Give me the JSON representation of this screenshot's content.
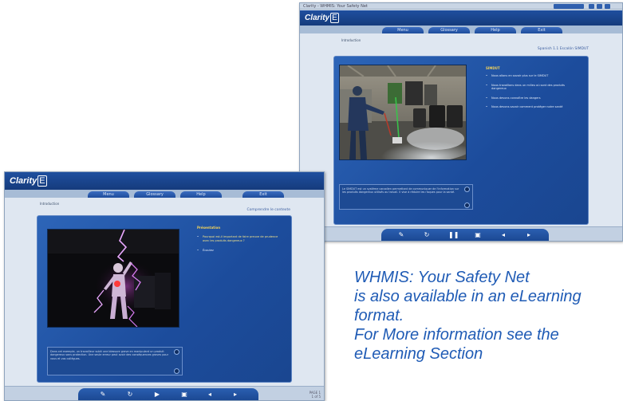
{
  "promo": {
    "lines": [
      "WHMIS: Your Safety Net",
      "is also available in an eLearning",
      "format.",
      "For More information see the",
      "eLearning Section"
    ]
  },
  "back_screenshot": {
    "window_title": "Clarity - WHMIS: Your Safety Net",
    "logo_text": "Clarity",
    "logo_box": "E",
    "nav_tabs": [
      "Menu",
      "Glossary",
      "Help",
      "Exit"
    ],
    "breadcrumb": "Introduction",
    "lesson_title": "Spanish 1.1 Escalón SIMDUT",
    "sidebar_title": "SIMDUT",
    "bullets": [
      "Nous allons en savoir plus sur le SIMDUT",
      "Nous travaillons dans un milieu où sont des produits dangereux",
      "Nous devons connaître les dangers",
      "Nous devons savoir comment protéger notre santé"
    ],
    "caption": "Le SIMDUT est un système canadien permettant de communiquer de l'information sur les produits dangereux utilisés au travail. Il vise à réduire les risques pour la santé.",
    "controls": [
      "pencil-icon",
      "refresh-icon",
      "pause-icon",
      "stop-icon",
      "back-icon",
      "forward-icon"
    ]
  },
  "front_screenshot": {
    "logo_text": "Clarity",
    "logo_box": "E",
    "nav_tabs": [
      "Menu",
      "Glossary",
      "Help",
      "Exit"
    ],
    "breadcrumb": "Introduction",
    "lesson_title": "Comprendre le contexte",
    "sidebar_title": "Présentation",
    "bullets": [
      "Pourquoi est-il important de faire preuve de prudence avec les produits dangereux ?",
      "Écoutez"
    ],
    "caption": "Dans cet exemple, un travailleur subit une blessure grave en manipulant un produit dangereux sans protection. Une seule erreur peut avoir des conséquences graves pour vous et vos collègues.",
    "controls": [
      "pencil-icon",
      "refresh-icon",
      "play-icon",
      "stop-icon",
      "back-icon",
      "forward-icon"
    ],
    "pager": [
      "PAGE 1",
      "1 of 5"
    ]
  }
}
